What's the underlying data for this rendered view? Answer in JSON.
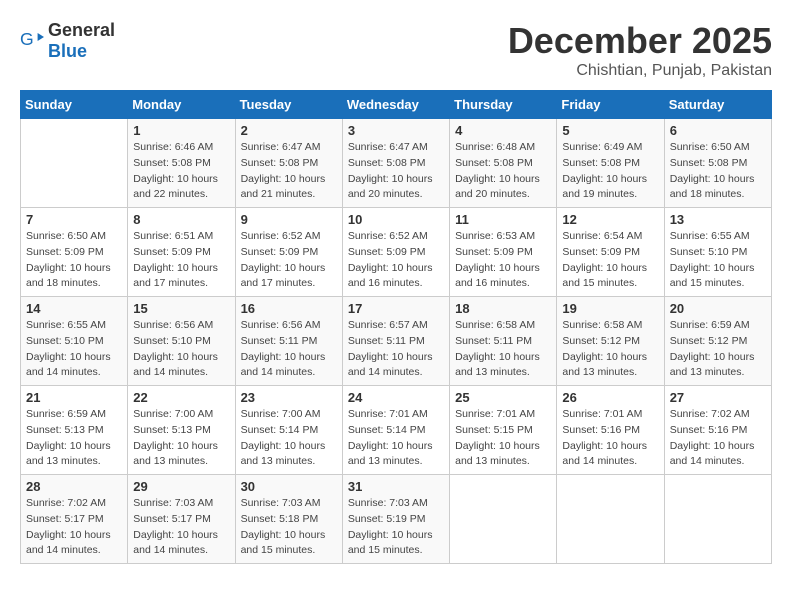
{
  "logo": {
    "general": "General",
    "blue": "Blue"
  },
  "title": "December 2025",
  "subtitle": "Chishtian, Punjab, Pakistan",
  "weekdays": [
    "Sunday",
    "Monday",
    "Tuesday",
    "Wednesday",
    "Thursday",
    "Friday",
    "Saturday"
  ],
  "weeks": [
    [
      {
        "day": "",
        "info": ""
      },
      {
        "day": "1",
        "info": "Sunrise: 6:46 AM\nSunset: 5:08 PM\nDaylight: 10 hours\nand 22 minutes."
      },
      {
        "day": "2",
        "info": "Sunrise: 6:47 AM\nSunset: 5:08 PM\nDaylight: 10 hours\nand 21 minutes."
      },
      {
        "day": "3",
        "info": "Sunrise: 6:47 AM\nSunset: 5:08 PM\nDaylight: 10 hours\nand 20 minutes."
      },
      {
        "day": "4",
        "info": "Sunrise: 6:48 AM\nSunset: 5:08 PM\nDaylight: 10 hours\nand 20 minutes."
      },
      {
        "day": "5",
        "info": "Sunrise: 6:49 AM\nSunset: 5:08 PM\nDaylight: 10 hours\nand 19 minutes."
      },
      {
        "day": "6",
        "info": "Sunrise: 6:50 AM\nSunset: 5:08 PM\nDaylight: 10 hours\nand 18 minutes."
      }
    ],
    [
      {
        "day": "7",
        "info": "Sunrise: 6:50 AM\nSunset: 5:09 PM\nDaylight: 10 hours\nand 18 minutes."
      },
      {
        "day": "8",
        "info": "Sunrise: 6:51 AM\nSunset: 5:09 PM\nDaylight: 10 hours\nand 17 minutes."
      },
      {
        "day": "9",
        "info": "Sunrise: 6:52 AM\nSunset: 5:09 PM\nDaylight: 10 hours\nand 17 minutes."
      },
      {
        "day": "10",
        "info": "Sunrise: 6:52 AM\nSunset: 5:09 PM\nDaylight: 10 hours\nand 16 minutes."
      },
      {
        "day": "11",
        "info": "Sunrise: 6:53 AM\nSunset: 5:09 PM\nDaylight: 10 hours\nand 16 minutes."
      },
      {
        "day": "12",
        "info": "Sunrise: 6:54 AM\nSunset: 5:09 PM\nDaylight: 10 hours\nand 15 minutes."
      },
      {
        "day": "13",
        "info": "Sunrise: 6:55 AM\nSunset: 5:10 PM\nDaylight: 10 hours\nand 15 minutes."
      }
    ],
    [
      {
        "day": "14",
        "info": "Sunrise: 6:55 AM\nSunset: 5:10 PM\nDaylight: 10 hours\nand 14 minutes."
      },
      {
        "day": "15",
        "info": "Sunrise: 6:56 AM\nSunset: 5:10 PM\nDaylight: 10 hours\nand 14 minutes."
      },
      {
        "day": "16",
        "info": "Sunrise: 6:56 AM\nSunset: 5:11 PM\nDaylight: 10 hours\nand 14 minutes."
      },
      {
        "day": "17",
        "info": "Sunrise: 6:57 AM\nSunset: 5:11 PM\nDaylight: 10 hours\nand 14 minutes."
      },
      {
        "day": "18",
        "info": "Sunrise: 6:58 AM\nSunset: 5:11 PM\nDaylight: 10 hours\nand 13 minutes."
      },
      {
        "day": "19",
        "info": "Sunrise: 6:58 AM\nSunset: 5:12 PM\nDaylight: 10 hours\nand 13 minutes."
      },
      {
        "day": "20",
        "info": "Sunrise: 6:59 AM\nSunset: 5:12 PM\nDaylight: 10 hours\nand 13 minutes."
      }
    ],
    [
      {
        "day": "21",
        "info": "Sunrise: 6:59 AM\nSunset: 5:13 PM\nDaylight: 10 hours\nand 13 minutes."
      },
      {
        "day": "22",
        "info": "Sunrise: 7:00 AM\nSunset: 5:13 PM\nDaylight: 10 hours\nand 13 minutes."
      },
      {
        "day": "23",
        "info": "Sunrise: 7:00 AM\nSunset: 5:14 PM\nDaylight: 10 hours\nand 13 minutes."
      },
      {
        "day": "24",
        "info": "Sunrise: 7:01 AM\nSunset: 5:14 PM\nDaylight: 10 hours\nand 13 minutes."
      },
      {
        "day": "25",
        "info": "Sunrise: 7:01 AM\nSunset: 5:15 PM\nDaylight: 10 hours\nand 13 minutes."
      },
      {
        "day": "26",
        "info": "Sunrise: 7:01 AM\nSunset: 5:16 PM\nDaylight: 10 hours\nand 14 minutes."
      },
      {
        "day": "27",
        "info": "Sunrise: 7:02 AM\nSunset: 5:16 PM\nDaylight: 10 hours\nand 14 minutes."
      }
    ],
    [
      {
        "day": "28",
        "info": "Sunrise: 7:02 AM\nSunset: 5:17 PM\nDaylight: 10 hours\nand 14 minutes."
      },
      {
        "day": "29",
        "info": "Sunrise: 7:03 AM\nSunset: 5:17 PM\nDaylight: 10 hours\nand 14 minutes."
      },
      {
        "day": "30",
        "info": "Sunrise: 7:03 AM\nSunset: 5:18 PM\nDaylight: 10 hours\nand 15 minutes."
      },
      {
        "day": "31",
        "info": "Sunrise: 7:03 AM\nSunset: 5:19 PM\nDaylight: 10 hours\nand 15 minutes."
      },
      {
        "day": "",
        "info": ""
      },
      {
        "day": "",
        "info": ""
      },
      {
        "day": "",
        "info": ""
      }
    ]
  ]
}
